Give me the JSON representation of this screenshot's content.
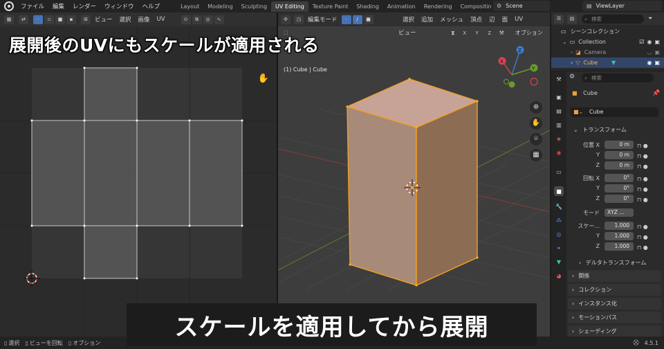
{
  "topbar": {
    "menus": [
      "ファイル",
      "編集",
      "レンダー",
      "ウィンドウ",
      "ヘルプ"
    ],
    "workspaces": [
      "Layout",
      "Modeling",
      "Sculpting",
      "UV Editing",
      "Texture Paint",
      "Shading",
      "Animation",
      "Rendering",
      "Compositin"
    ],
    "active_workspace": "UV Editing",
    "scene": "Scene",
    "view_layer": "ViewLayer"
  },
  "uv_editor": {
    "menus": [
      "ビュー",
      "選択",
      "画像",
      "UV"
    ]
  },
  "viewport": {
    "mode": "編集モード",
    "menus": [
      "ビュー",
      "選択",
      "追加",
      "メッシュ",
      "頂点",
      "辺",
      "面",
      "UV"
    ],
    "axes": [
      "X",
      "Y",
      "Z"
    ],
    "options": "オプション",
    "object_info": "(1) Cube | Cube",
    "gizmo_axes": [
      "X",
      "Y",
      "Z"
    ]
  },
  "outliner": {
    "search_placeholder": "検索",
    "scene_collection": "シーンコレクション",
    "collection": "Collection",
    "camera": "Camera",
    "cube": "Cube"
  },
  "properties": {
    "search_placeholder": "検索",
    "object_name": "Cube",
    "data_name": "Cube",
    "transform_label": "トランスフォーム",
    "location_label": "位置 X",
    "location": {
      "x": "0 m",
      "y": "0 m",
      "z": "0 m"
    },
    "rotation_label": "回転 X",
    "rotation": {
      "x": "0°",
      "y": "0°",
      "z": "0°"
    },
    "mode_label": "モード",
    "mode_value": "XYZ ...",
    "scale_label": "スケー...",
    "scale": {
      "x": "1.000",
      "y": "1.000",
      "z": "1.000"
    },
    "axis_y": "Y",
    "axis_z": "Z",
    "panels": [
      "デルタトランスフォーム",
      "関係",
      "コレクション",
      "インスタンス化",
      "モーションパス",
      "シェーディング"
    ]
  },
  "statusbar": {
    "select": "選択",
    "rotate_view": "ビューを回転",
    "options": "オプション",
    "version": "4.5.1"
  },
  "captions": {
    "top": "展開後のUVにもスケールが適用される",
    "bottom": "スケールを適用してから展開"
  }
}
